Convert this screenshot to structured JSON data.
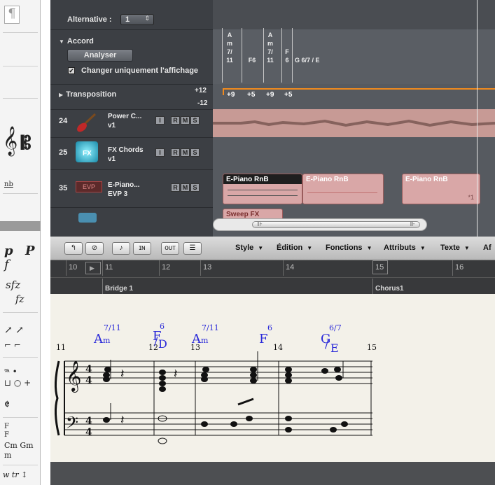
{
  "palette": {
    "items": [
      "¶",
      "p",
      "P",
      "f",
      "sfz",
      "fz",
      "F",
      "F",
      "Cm Gm",
      "m",
      "tr"
    ]
  },
  "inspector": {
    "alternative_label": "Alternative :",
    "alternative_value": "1",
    "chord_section": "Accord",
    "analyse_button": "Analyser",
    "display_only_label": "Changer uniquement l'affichage",
    "transposition_label": "Transposition",
    "trans_up": "+12",
    "trans_down": "-12"
  },
  "chord_track": {
    "chords": [
      {
        "lines": [
          "A",
          "m",
          "7/",
          "11"
        ]
      },
      {
        "lines": [
          "F6"
        ]
      },
      {
        "lines": [
          "A",
          "m",
          "7/",
          "11"
        ]
      },
      {
        "lines": [
          "F",
          "6"
        ]
      },
      {
        "lines": [
          "G 6/7 / E"
        ]
      }
    ],
    "transpositions": [
      "+9",
      "+5",
      "+9",
      "+5"
    ]
  },
  "tracks": [
    {
      "number": "24",
      "name": "Power C...",
      "sub": "v1",
      "buttons": [
        "I",
        "R",
        "M",
        "S"
      ]
    },
    {
      "number": "25",
      "name": "FX Chords",
      "sub": "v1",
      "buttons": [
        "I",
        "R",
        "M",
        "S"
      ]
    },
    {
      "number": "35",
      "name": "E-Piano...",
      "sub": "EVP 3",
      "buttons": [
        "R",
        "M",
        "S"
      ]
    },
    {
      "number": "",
      "name": "Sweep FX",
      "sub": "",
      "buttons": []
    }
  ],
  "regions": {
    "epiano_selected": "E-Piano RnB",
    "epiano_2": "E-Piano RnB",
    "epiano_3": "E-Piano RnB",
    "sweep": "Sweep FX",
    "epiano_num": "*1"
  },
  "score_toolbar": {
    "menus": [
      "Style",
      "Édition",
      "Fonctions",
      "Attributs",
      "Texte",
      "Af"
    ]
  },
  "ruler": {
    "bars": [
      "10",
      "11",
      "12",
      "13",
      "14",
      "15",
      "16"
    ],
    "markers": [
      "Bridge 1",
      "Chorus1"
    ]
  },
  "score": {
    "bar_numbers": [
      "11",
      "12",
      "13",
      "14",
      "15"
    ],
    "chords": [
      {
        "root": "A",
        "quality": "m",
        "ext": "7/11"
      },
      {
        "root": "F",
        "ext": "6",
        "bass": "D"
      },
      {
        "root": "A",
        "quality": "m",
        "ext": "7/11"
      },
      {
        "root": "F",
        "ext": "6"
      },
      {
        "root": "G",
        "ext": "6/7",
        "bass": "E"
      }
    ],
    "time_sig": "4/4"
  }
}
